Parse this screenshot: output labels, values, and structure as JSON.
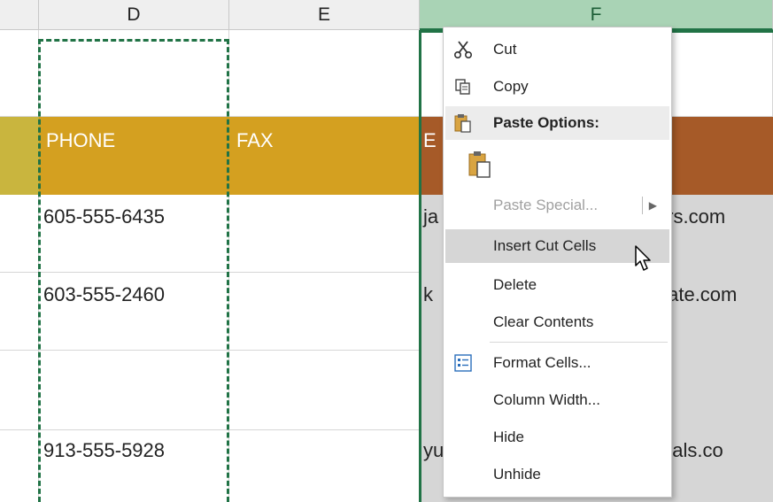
{
  "columns": [
    {
      "letter": "D"
    },
    {
      "letter": "E"
    },
    {
      "letter": "F"
    }
  ],
  "header_row": {
    "phone": "PHONE",
    "fax": "FAX",
    "email_partial": "E"
  },
  "rows": [
    {
      "phone": "605-555-6435",
      "fax": "",
      "email_left": "ja",
      "email_right": "ers.com"
    },
    {
      "phone": "603-555-2460",
      "fax": "",
      "email_left": "k",
      "email_right": "tate.com"
    },
    {
      "phone": "",
      "fax": "",
      "email_left": "",
      "email_right": ""
    },
    {
      "phone": "913-555-5928",
      "fax": "",
      "email_left": "yu",
      "email_right": "uticals.co"
    }
  ],
  "colors": {
    "header_gold": "#d4a020",
    "header_rust": "#a65a28",
    "header_olive": "#c9b53e",
    "selection_green": "#217346"
  },
  "context_menu": {
    "cut": "Cut",
    "copy": "Copy",
    "paste_options": "Paste Options:",
    "paste_special": "Paste Special...",
    "insert_cut_cells": "Insert Cut Cells",
    "delete": "Delete",
    "clear_contents": "Clear Contents",
    "format_cells": "Format Cells...",
    "column_width": "Column Width...",
    "hide": "Hide",
    "unhide": "Unhide"
  },
  "icons": {
    "cut": "scissors-icon",
    "copy": "copy-icon",
    "paste_options": "clipboard-icon",
    "paste": "paste-icon",
    "format_cells": "format-cells-icon",
    "submenu": "submenu-arrow-icon",
    "cursor": "mouse-pointer-icon"
  }
}
